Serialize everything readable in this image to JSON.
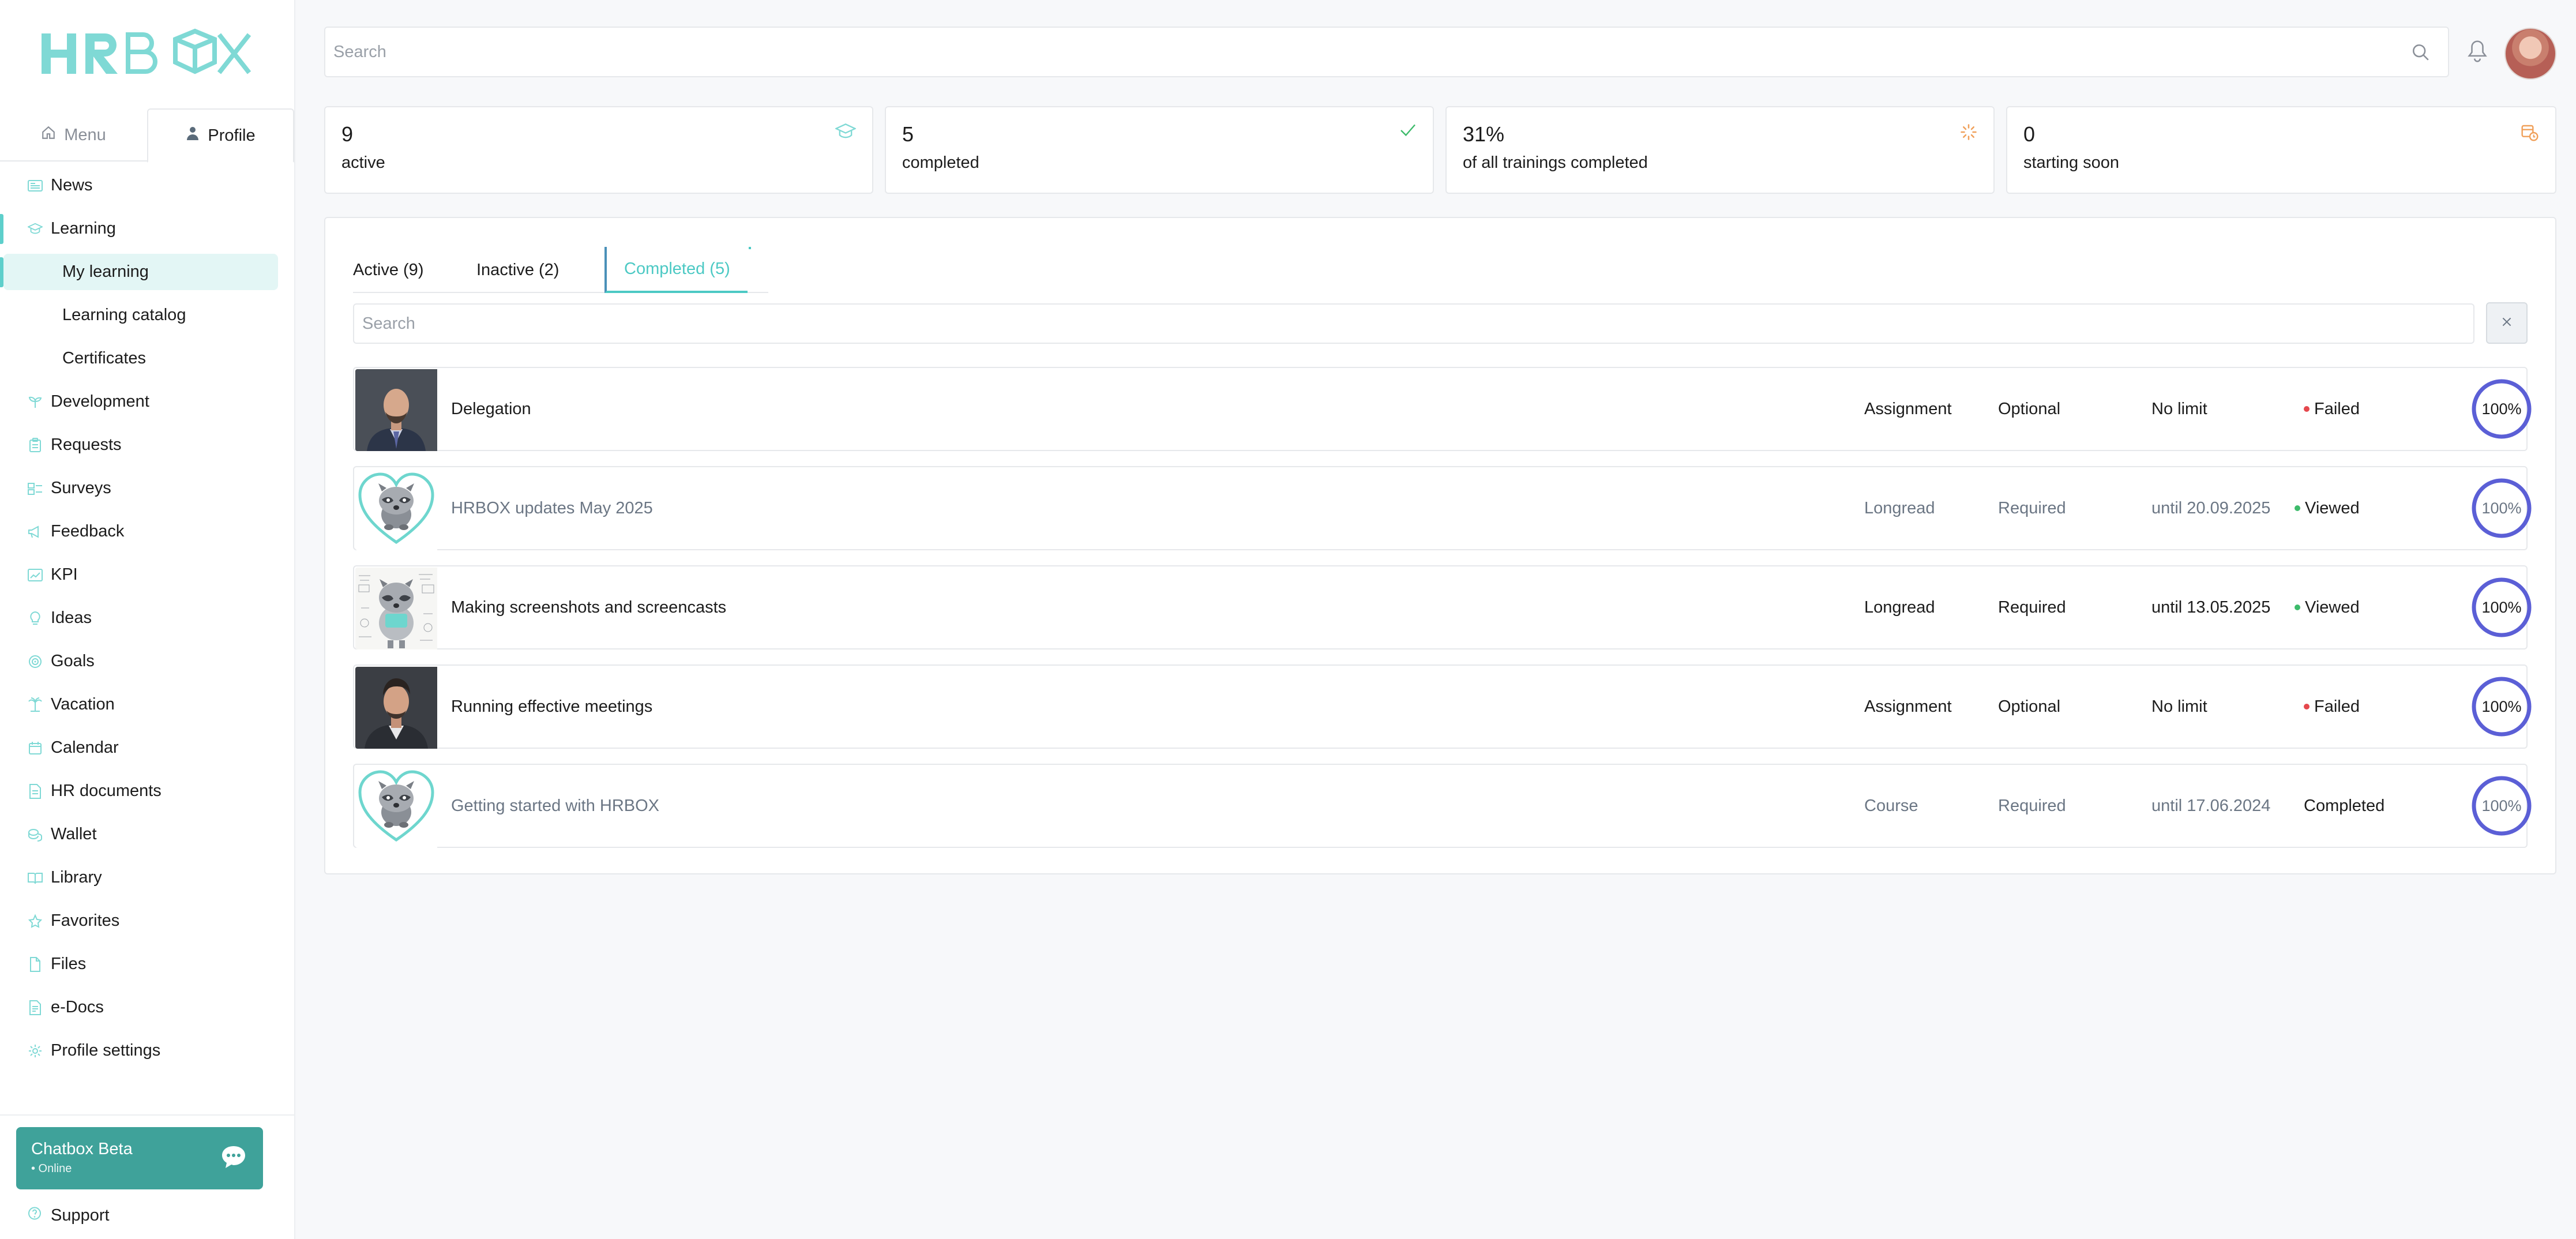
{
  "brand": {
    "logo_text": "HRBOX",
    "accent": "#5ecfcb",
    "ring_color": "#5b5fd6"
  },
  "sidebar": {
    "tabs": [
      {
        "label": "Menu",
        "icon": "home-icon"
      },
      {
        "label": "Profile",
        "icon": "person-icon"
      }
    ],
    "items": [
      {
        "label": "News",
        "icon": "newspaper-icon"
      },
      {
        "label": "Learning",
        "icon": "graduation-cap-icon"
      },
      {
        "label": "My learning",
        "icon": "",
        "sub": true,
        "selected": true
      },
      {
        "label": "Learning catalog",
        "icon": "",
        "sub": true
      },
      {
        "label": "Certificates",
        "icon": "",
        "sub": true
      },
      {
        "label": "Development",
        "icon": "sprout-icon"
      },
      {
        "label": "Requests",
        "icon": "clipboard-icon"
      },
      {
        "label": "Surveys",
        "icon": "survey-icon"
      },
      {
        "label": "Feedback",
        "icon": "megaphone-icon"
      },
      {
        "label": "KPI",
        "icon": "kpi-icon"
      },
      {
        "label": "Ideas",
        "icon": "lightbulb-icon"
      },
      {
        "label": "Goals",
        "icon": "target-icon"
      },
      {
        "label": "Vacation",
        "icon": "palm-tree-icon"
      },
      {
        "label": "Calendar",
        "icon": "calendar-icon"
      },
      {
        "label": "HR documents",
        "icon": "document-icon"
      },
      {
        "label": "Wallet",
        "icon": "coins-icon"
      },
      {
        "label": "Library",
        "icon": "book-icon"
      },
      {
        "label": "Favorites",
        "icon": "star-icon"
      },
      {
        "label": "Files",
        "icon": "file-icon"
      },
      {
        "label": "e-Docs",
        "icon": "edoc-icon"
      },
      {
        "label": "Profile settings",
        "icon": "gear-icon"
      }
    ],
    "chatbox": {
      "title": "Chatbox Beta",
      "status": "• Online"
    },
    "support": "Support"
  },
  "topbar": {
    "search_placeholder": "Search"
  },
  "stats": [
    {
      "value": "9",
      "label": "active",
      "icon": "graduation-cap-icon"
    },
    {
      "value": "5",
      "label": "completed",
      "icon": "check-icon"
    },
    {
      "value": "31%",
      "label": "of all trainings completed",
      "icon": "spinner-icon"
    },
    {
      "value": "0",
      "label": "starting soon",
      "icon": "calendar-clock-icon"
    }
  ],
  "tabs": [
    {
      "label": "Active (9)"
    },
    {
      "label": "Inactive (2)"
    },
    {
      "label": "Completed (5)"
    }
  ],
  "list_search_placeholder": "Search",
  "rows": [
    {
      "title": "Delegation",
      "type": "Assignment",
      "requirement": "Optional",
      "due": "No limit",
      "status": "Failed",
      "status_color": "#e5484d",
      "progress": "100%",
      "thumb": "man-bald"
    },
    {
      "title": "HRBOX updates May 2025",
      "type": "Longread",
      "requirement": "Required",
      "due": "until 20.09.2025",
      "status": "Viewed",
      "status_color": "#3dbb6b",
      "progress": "100%",
      "thumb": "raccoon-heart"
    },
    {
      "title": "Making screenshots and screencasts",
      "type": "Longread",
      "requirement": "Required",
      "due": "until 13.05.2025",
      "status": "Viewed",
      "status_color": "#3dbb6b",
      "progress": "100%",
      "thumb": "raccoon-sketch"
    },
    {
      "title": "Running effective meetings",
      "type": "Assignment",
      "requirement": "Optional",
      "due": "No limit",
      "status": "Failed",
      "status_color": "#e5484d",
      "progress": "100%",
      "thumb": "man-suit"
    },
    {
      "title": "Getting started with HRBOX",
      "type": "Course",
      "requirement": "Required",
      "due": "until 17.06.2024",
      "status": "Completed",
      "status_color": "",
      "progress": "100%",
      "thumb": "raccoon-heart"
    }
  ]
}
